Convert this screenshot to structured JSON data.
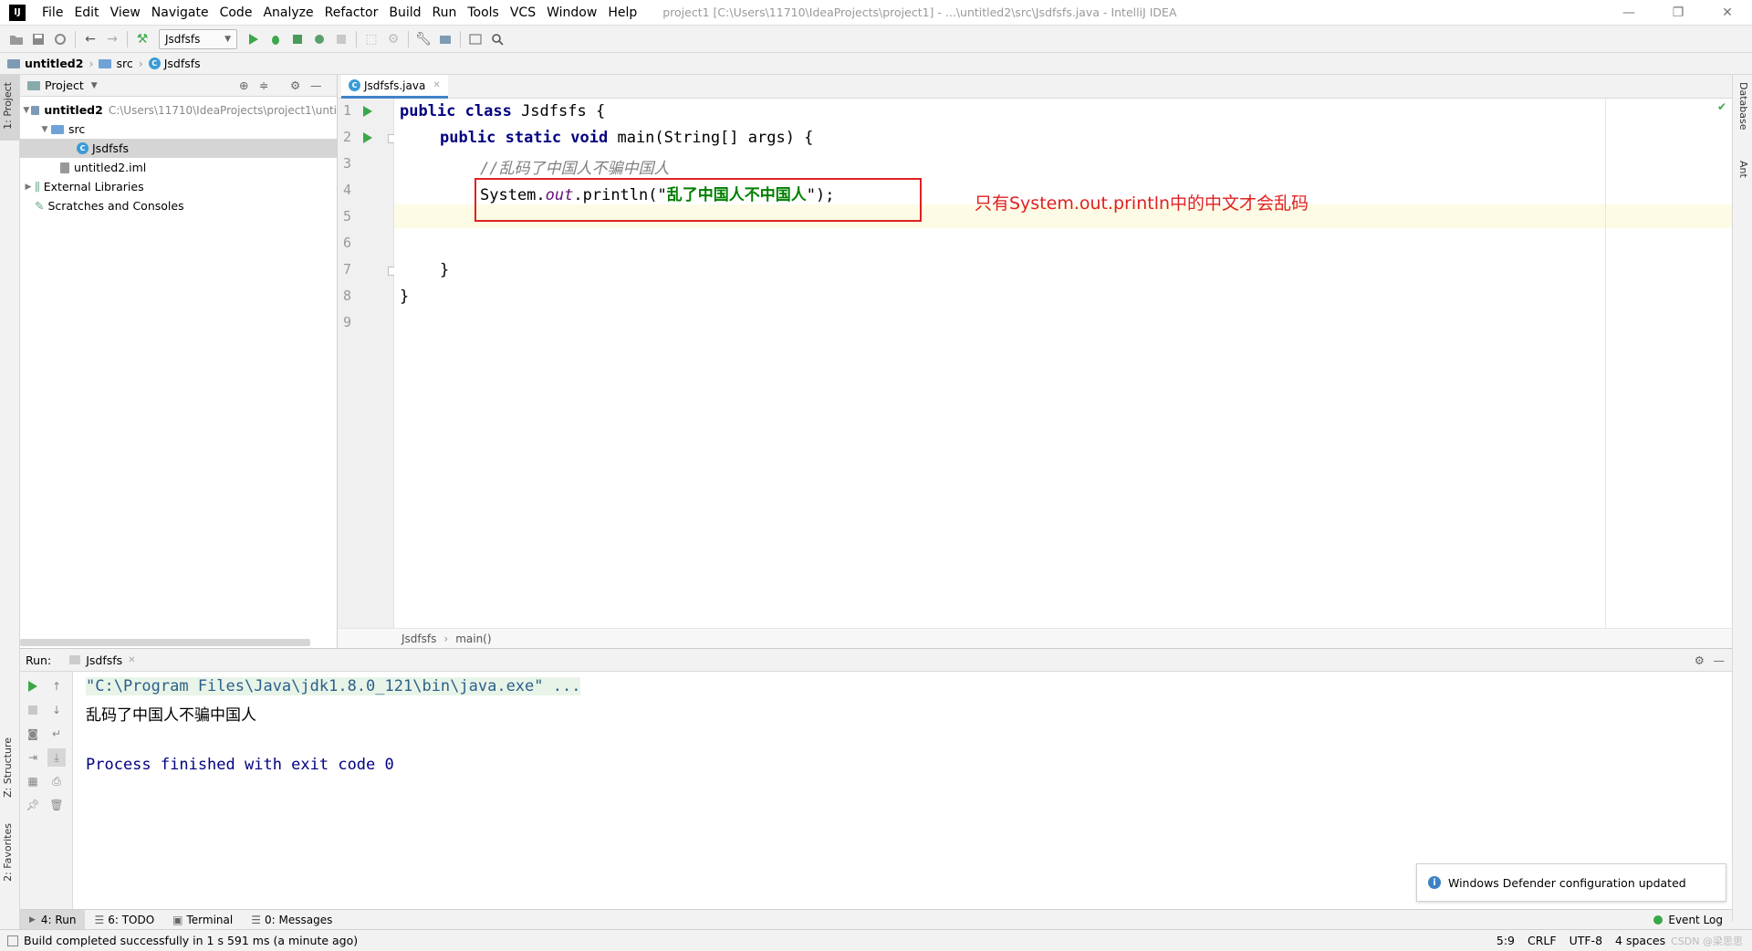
{
  "window": {
    "title": "project1 [C:\\Users\\11710\\IdeaProjects\\project1] - ...\\untitled2\\src\\Jsdfsfs.java - IntelliJ IDEA",
    "logo": "IJ",
    "minimize": "—",
    "restore": "❐",
    "close": "✕"
  },
  "menu": [
    "File",
    "Edit",
    "View",
    "Navigate",
    "Code",
    "Analyze",
    "Refactor",
    "Build",
    "Run",
    "Tools",
    "VCS",
    "Window",
    "Help"
  ],
  "toolbar": {
    "run_config": "Jsdfsfs"
  },
  "navbar": {
    "crumbs": [
      "untitled2",
      "src",
      "Jsdfsfs"
    ]
  },
  "left_tabs": {
    "project": "1: Project",
    "structure": "Z: Structure",
    "favorites": "2: Favorites"
  },
  "right_tabs": {
    "database": "Database",
    "ant": "Ant"
  },
  "project_panel": {
    "title": "Project",
    "tree": {
      "root": "untitled2",
      "root_path": "C:\\Users\\11710\\IdeaProjects\\project1\\unti",
      "src": "src",
      "class_file": "Jsdfsfs",
      "iml": "untitled2.iml",
      "external": "External Libraries",
      "scratches": "Scratches and Consoles"
    }
  },
  "editor": {
    "tab_label": "Jsdfsfs.java",
    "line_numbers": [
      "1",
      "2",
      "3",
      "4",
      "5",
      "6",
      "7",
      "8",
      "9"
    ],
    "code": {
      "l1_kw": "public class",
      "l1_rest": " Jsdfsfs {",
      "l2_kw": "public static void",
      "l2_rest": " main(String[] args) {",
      "l3": "//乱码了中国人不骗中国人",
      "l4_a": "System.",
      "l4_field": "out",
      "l4_b": ".println(\"",
      "l4_str": "乱了中国人不中国人",
      "l4_c": "\");",
      "l7": "}",
      "l8": "}"
    },
    "annotation": "只有System.out.println中的中文才会乱码",
    "breadcrumb": [
      "Jsdfsfs",
      "main()"
    ]
  },
  "run_panel": {
    "label": "Run:",
    "tab": "Jsdfsfs",
    "console": {
      "cmd": "\"C:\\Program Files\\Java\\jdk1.8.0_121\\bin\\java.exe\" ...",
      "output": "乱码了中国人不骗中国人",
      "exit": "Process finished with exit code 0"
    }
  },
  "notification": "Windows Defender configuration updated",
  "bottom_tabs": {
    "run": "4: Run",
    "todo": "6: TODO",
    "terminal": "Terminal",
    "messages": "0: Messages",
    "event_log": "Event Log"
  },
  "status": {
    "message": "Build completed successfully in 1 s 591 ms (a minute ago)",
    "position": "5:9",
    "line_sep": "CRLF",
    "encoding": "UTF-8",
    "indent": "4 spaces",
    "watermark": "CSDN @梁思思"
  },
  "colors": {
    "accent": "#4083c9",
    "run_green": "#3aa84a",
    "annotation_red": "#e02020",
    "keyword": "#000080",
    "string": "#008000"
  }
}
